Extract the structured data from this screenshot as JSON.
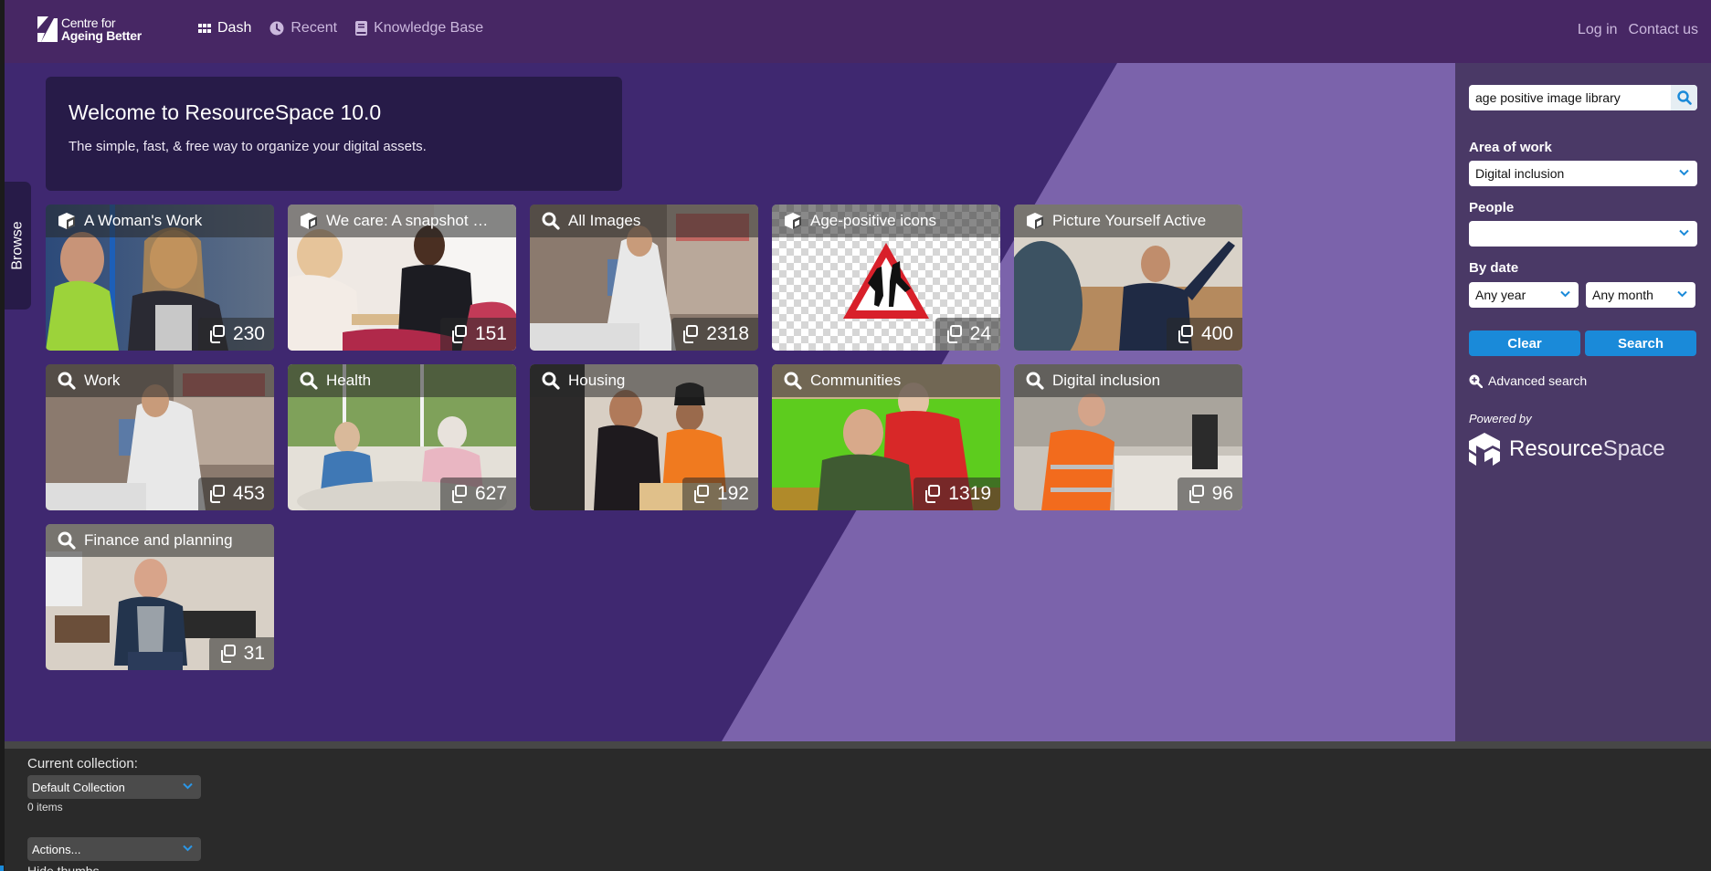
{
  "header": {
    "logo": {
      "line1": "Centre for",
      "line2": "Ageing Better"
    },
    "nav": [
      {
        "label": "Dash",
        "icon": "grid-icon",
        "active": true
      },
      {
        "label": "Recent",
        "icon": "clock-icon",
        "active": false
      },
      {
        "label": "Knowledge Base",
        "icon": "book-icon",
        "active": false
      }
    ],
    "right_links": [
      {
        "label": "Log in"
      },
      {
        "label": "Contact us"
      }
    ]
  },
  "welcome": {
    "title": "Welcome to ResourceSpace 10.0",
    "subtitle": "The simple, fast, & free way to organize your digital assets."
  },
  "browse_tab": {
    "label": "Browse"
  },
  "tiles": [
    {
      "title": "A Woman's Work",
      "icon": "collection-cube-icon",
      "count": "230"
    },
    {
      "title": "We care: A snapshot …",
      "icon": "collection-cube-icon",
      "count": "151"
    },
    {
      "title": "All Images",
      "icon": "search-icon",
      "count": "2318"
    },
    {
      "title": "Age-positive icons",
      "icon": "collection-cube-icon",
      "count": "24"
    },
    {
      "title": "Picture Yourself Active",
      "icon": "collection-cube-icon",
      "count": "400"
    },
    {
      "title": "Work",
      "icon": "search-icon",
      "count": "453"
    },
    {
      "title": "Health",
      "icon": "search-icon",
      "count": "627"
    },
    {
      "title": "Housing",
      "icon": "search-icon",
      "count": "192"
    },
    {
      "title": "Communities",
      "icon": "search-icon",
      "count": "1319"
    },
    {
      "title": "Digital inclusion",
      "icon": "search-icon",
      "count": "96"
    },
    {
      "title": "Finance and planning",
      "icon": "search-icon",
      "count": "31"
    }
  ],
  "sidebar": {
    "search_value": "age positive image library",
    "area_of_work": {
      "label": "Area of work",
      "value": "Digital inclusion"
    },
    "people": {
      "label": "People",
      "value": ""
    },
    "by_date": {
      "label": "By date",
      "year": "Any year",
      "month": "Any month"
    },
    "clear_label": "Clear",
    "search_label": "Search",
    "advanced_search_label": "Advanced search",
    "powered_by": "Powered by",
    "brand_bold": "Resource",
    "brand_light": "Space"
  },
  "footer": {
    "current_collection_label": "Current collection:",
    "collection_value": "Default Collection",
    "items_count": "0 items",
    "actions_value": "Actions...",
    "hide_thumbs_label": "Hide thumbs"
  },
  "colors": {
    "header_bg": "#472764",
    "main_bg": "#3f2870",
    "accent_light_purple": "#7b63ab",
    "sidebar_bg": "#4a3966",
    "button_blue": "#1a8ad9",
    "footer_bg": "#2a2a2a"
  }
}
